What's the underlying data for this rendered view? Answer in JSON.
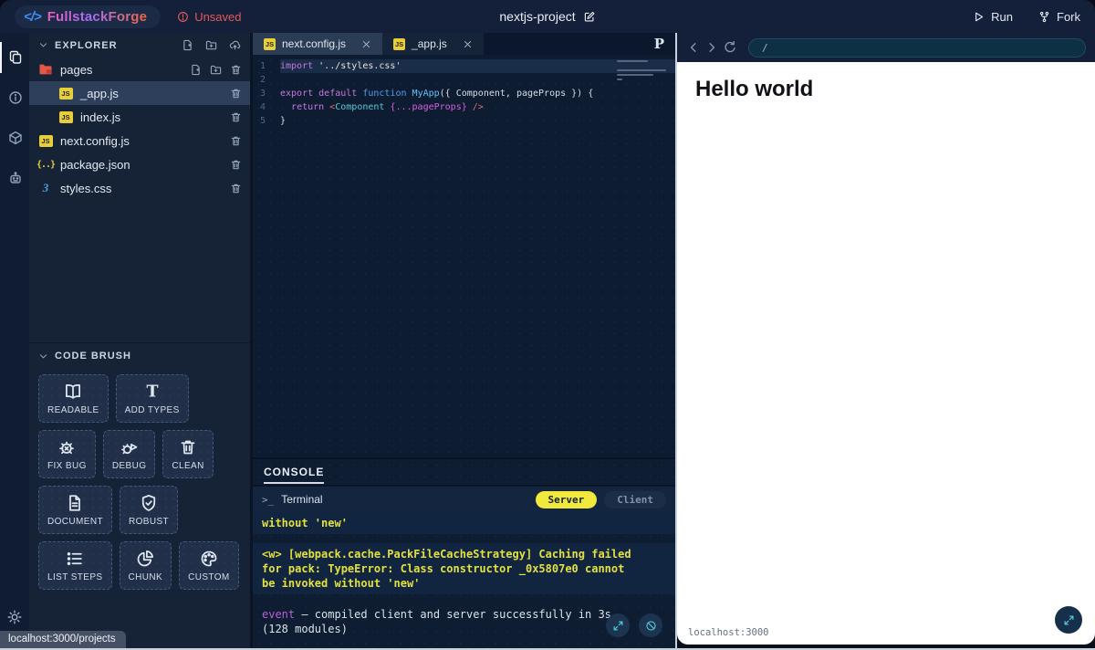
{
  "topbar": {
    "logo_glyph": "</>",
    "brand": "FullstackForge",
    "unsaved_label": "Unsaved",
    "project_title": "nextjs-project",
    "run_label": "Run",
    "fork_label": "Fork"
  },
  "activity_bar": {
    "items": [
      {
        "name": "files",
        "icon": "files-icon",
        "active": true
      },
      {
        "name": "info",
        "icon": "info-icon",
        "active": false
      },
      {
        "name": "packages",
        "icon": "cube-icon",
        "active": false
      },
      {
        "name": "assistant",
        "icon": "robot-icon",
        "active": false
      }
    ],
    "theme_toggle_icon": "sun-icon"
  },
  "explorer": {
    "title": "EXPLORER",
    "header_actions": [
      "new-file-icon",
      "new-folder-icon",
      "upload-icon"
    ],
    "files": [
      {
        "name": "pages",
        "icon": "folder-icon",
        "indent": 0,
        "selected": false,
        "row_actions": [
          "new-file-icon",
          "new-folder-icon",
          "trash-icon"
        ]
      },
      {
        "name": "_app.js",
        "icon": "js-icon",
        "indent": 1,
        "selected": true,
        "row_actions": [
          "trash-icon"
        ]
      },
      {
        "name": "index.js",
        "icon": "js-icon",
        "indent": 1,
        "selected": false,
        "row_actions": [
          "trash-icon"
        ]
      },
      {
        "name": "next.config.js",
        "icon": "js-icon",
        "indent": 0,
        "selected": false,
        "row_actions": [
          "trash-icon"
        ]
      },
      {
        "name": "package.json",
        "icon": "json-icon",
        "indent": 0,
        "selected": false,
        "row_actions": [
          "trash-icon"
        ]
      },
      {
        "name": "styles.css",
        "icon": "css-icon",
        "indent": 0,
        "selected": false,
        "row_actions": [
          "trash-icon"
        ]
      }
    ]
  },
  "code_brush": {
    "title": "CODE BRUSH",
    "brushes": [
      {
        "label": "READABLE",
        "icon": "book-icon"
      },
      {
        "label": "ADD TYPES",
        "icon": "type-icon"
      },
      {
        "label": "FIX BUG",
        "icon": "bug-fix-icon"
      },
      {
        "label": "DEBUG",
        "icon": "bug-debug-icon"
      },
      {
        "label": "CLEAN",
        "icon": "trash-icon"
      },
      {
        "label": "DOCUMENT",
        "icon": "document-icon"
      },
      {
        "label": "ROBUST",
        "icon": "shield-check-icon"
      },
      {
        "label": "LIST STEPS",
        "icon": "list-steps-icon"
      },
      {
        "label": "CHUNK",
        "icon": "pie-chart-icon"
      },
      {
        "label": "CUSTOM",
        "icon": "palette-icon"
      }
    ]
  },
  "editor": {
    "tabs": [
      {
        "name": "next.config.js",
        "icon": "js-icon",
        "active": true
      },
      {
        "name": "_app.js",
        "icon": "js-icon",
        "active": false
      }
    ],
    "formatter_badge": "P",
    "code_lines": [
      {
        "n": "1",
        "active": true,
        "tokens": [
          {
            "t": "import",
            "c": "kw"
          },
          {
            "t": " ",
            "c": "pl"
          },
          {
            "t": "'../styles.css'",
            "c": "str"
          }
        ]
      },
      {
        "n": "2",
        "active": false,
        "tokens": []
      },
      {
        "n": "3",
        "active": false,
        "tokens": [
          {
            "t": "export",
            "c": "kw"
          },
          {
            "t": " ",
            "c": "pl"
          },
          {
            "t": "default",
            "c": "kw"
          },
          {
            "t": " ",
            "c": "pl"
          },
          {
            "t": "function",
            "c": "kw2"
          },
          {
            "t": " ",
            "c": "pl"
          },
          {
            "t": "MyApp",
            "c": "fn"
          },
          {
            "t": "({ Component, pageProps }) {",
            "c": "pl"
          }
        ]
      },
      {
        "n": "4",
        "active": false,
        "tokens": [
          {
            "t": "  ",
            "c": "pl"
          },
          {
            "t": "return",
            "c": "kw"
          },
          {
            "t": " ",
            "c": "pl"
          },
          {
            "t": "<",
            "c": "pk"
          },
          {
            "t": "Component",
            "c": "tag"
          },
          {
            "t": " ",
            "c": "pl"
          },
          {
            "t": "{...pageProps}",
            "c": "spread"
          },
          {
            "t": " ",
            "c": "pl"
          },
          {
            "t": "/>",
            "c": "pk"
          }
        ]
      },
      {
        "n": "5",
        "active": false,
        "tokens": [
          {
            "t": "}",
            "c": "pl"
          }
        ]
      }
    ]
  },
  "console": {
    "title": "CONSOLE",
    "prompt_glyph": ">_",
    "terminal_label": "Terminal",
    "server_label": "Server",
    "client_label": "Client",
    "entries": [
      {
        "kind": "warning",
        "text": "without 'new'"
      },
      {
        "kind": "warning",
        "text": "<w> [webpack.cache.PackFileCacheStrategy] Caching failed for pack: TypeError: Class constructor _0x5807e0 cannot be invoked without 'new'"
      },
      {
        "kind": "event",
        "prefix": "event",
        "text": "— compiled client and server successfully in 3s (128 modules)"
      }
    ]
  },
  "preview": {
    "url_value": "/",
    "heading": "Hello world",
    "status_label": "localhost:3000"
  },
  "status_tooltip": {
    "text": "localhost:3000/projects"
  },
  "colors": {
    "brand_gradient": [
      "#ef5ab9",
      "#a76bf8",
      "#f4683e"
    ],
    "logo_blue": "#3f8cf3",
    "warning_red": "#e05b5b",
    "console_warning_yellow": "#e3e13e",
    "server_pill_yellow": "#f1e93c",
    "event_purple": "#bb5fd6",
    "accent_teal": "#57c7d8"
  }
}
